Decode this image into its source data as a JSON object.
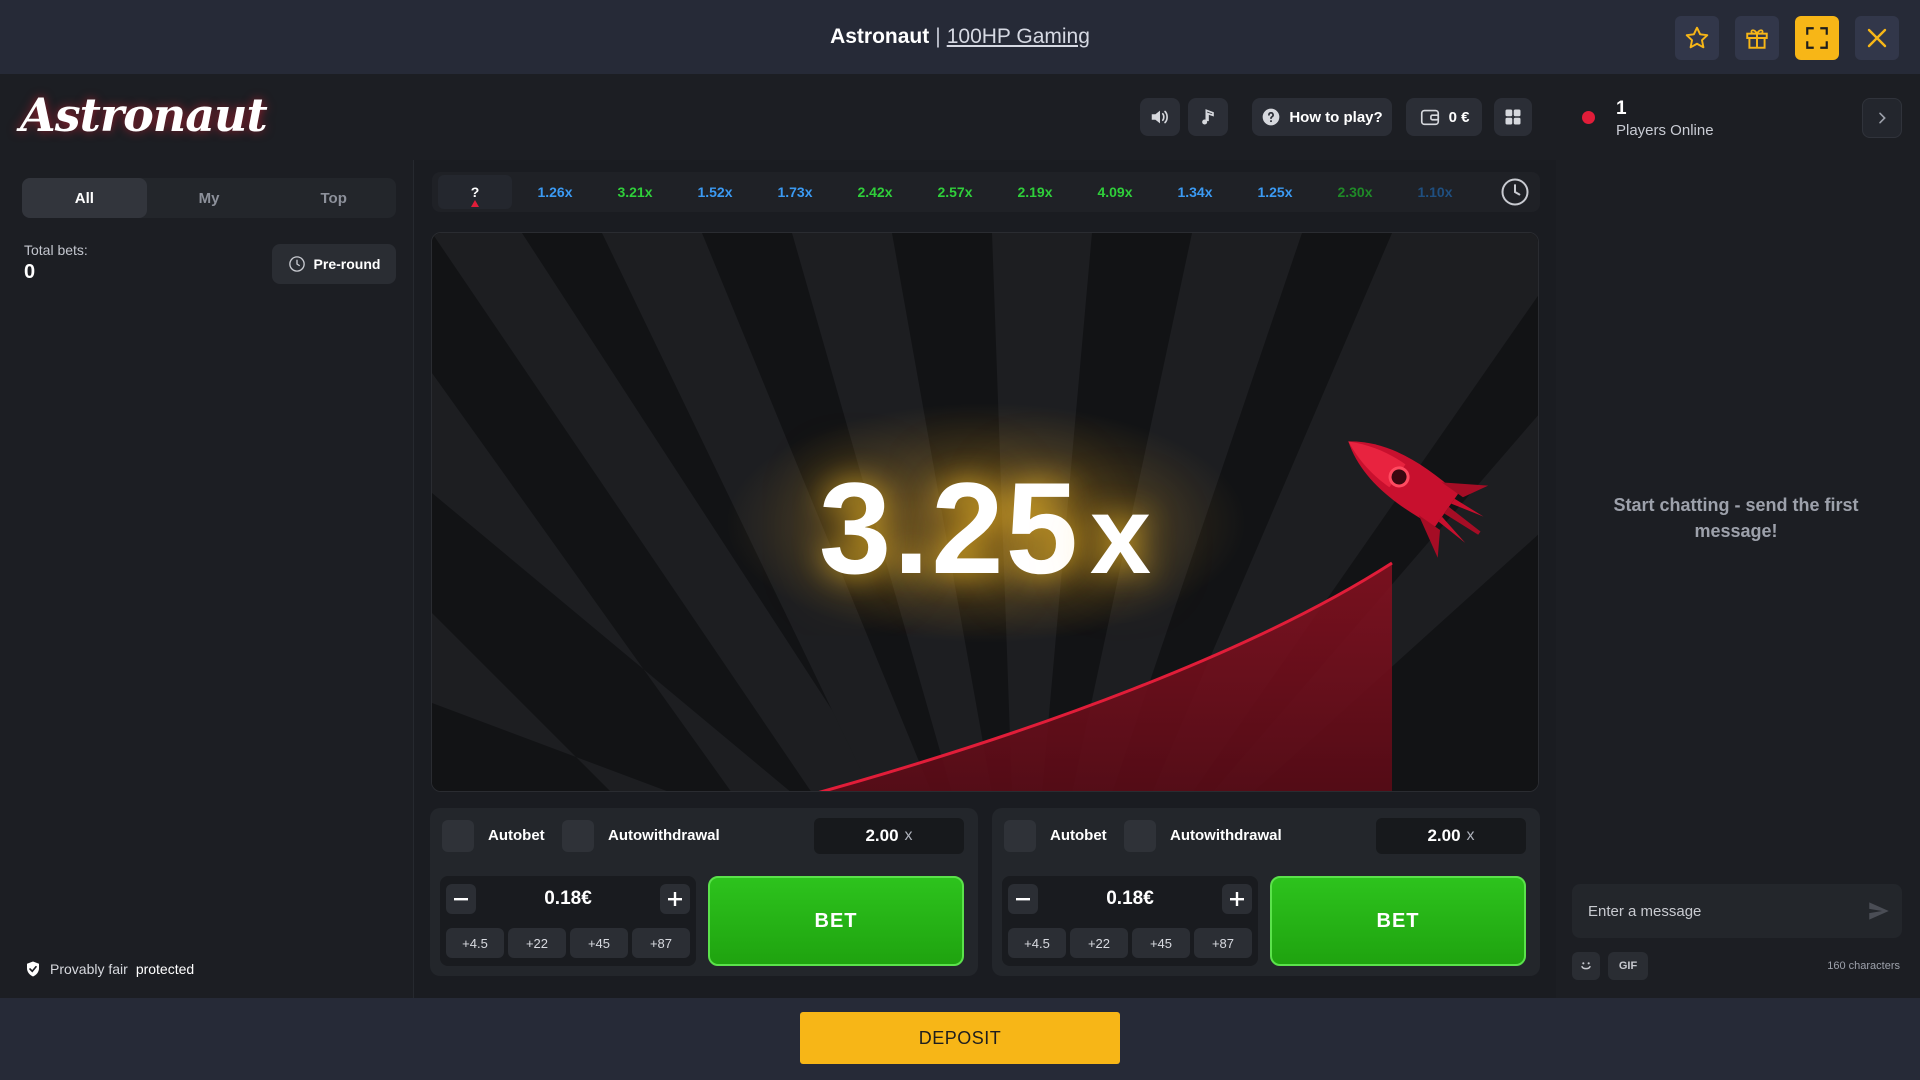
{
  "frame": {
    "game_title": "Astronaut",
    "separator": "|",
    "provider": "100HP Gaming"
  },
  "header": {
    "logo_text": "Astronaut",
    "how_to_play": "How to play?",
    "balance": "0 €",
    "players_online_count": "1",
    "players_online_label": "Players Online"
  },
  "left": {
    "tabs": [
      "All",
      "My",
      "Top"
    ],
    "active_tab": "All",
    "total_bets_label": "Total bets:",
    "total_bets_value": "0",
    "preround_label": "Pre-round",
    "provably_fair": "Provably fair",
    "protected": "protected"
  },
  "history": {
    "current": "?",
    "items": [
      {
        "value": "1.26x",
        "color": "#3b9af3"
      },
      {
        "value": "3.21x",
        "color": "#2fcf3a"
      },
      {
        "value": "1.52x",
        "color": "#3b9af3"
      },
      {
        "value": "1.73x",
        "color": "#3b9af3"
      },
      {
        "value": "2.42x",
        "color": "#2fcf3a"
      },
      {
        "value": "2.57x",
        "color": "#2fcf3a"
      },
      {
        "value": "2.19x",
        "color": "#2fcf3a"
      },
      {
        "value": "4.09x",
        "color": "#2fcf3a"
      },
      {
        "value": "1.34x",
        "color": "#3b9af3"
      },
      {
        "value": "1.25x",
        "color": "#3b9af3"
      },
      {
        "value": "2.30x",
        "color": "#1f8a27"
      },
      {
        "value": "1.10x",
        "color": "#1f4f80"
      }
    ]
  },
  "game": {
    "multiplier": "3.25",
    "multiplier_suffix": "x"
  },
  "bet_panels": [
    {
      "autobet_label": "Autobet",
      "autowithdrawal_label": "Autowithdrawal",
      "cashout_value": "2.00",
      "cashout_suffix": "x",
      "amount": "0.18€",
      "quick": [
        "+4.5",
        "+22",
        "+45",
        "+87"
      ],
      "bet_label": "BET"
    },
    {
      "autobet_label": "Autobet",
      "autowithdrawal_label": "Autowithdrawal",
      "cashout_value": "2.00",
      "cashout_suffix": "x",
      "amount": "0.18€",
      "quick": [
        "+4.5",
        "+22",
        "+45",
        "+87"
      ],
      "bet_label": "BET"
    }
  ],
  "chat": {
    "empty_text": "Start chatting - send the first message!",
    "placeholder": "Enter a message",
    "gif_label": "GIF",
    "char_limit": "160 characters"
  },
  "footer": {
    "deposit_label": "DEPOSIT"
  },
  "colors": {
    "accent": "#f7b617",
    "bet_green": "#2dc31d",
    "rocket_red": "#e11d39"
  }
}
